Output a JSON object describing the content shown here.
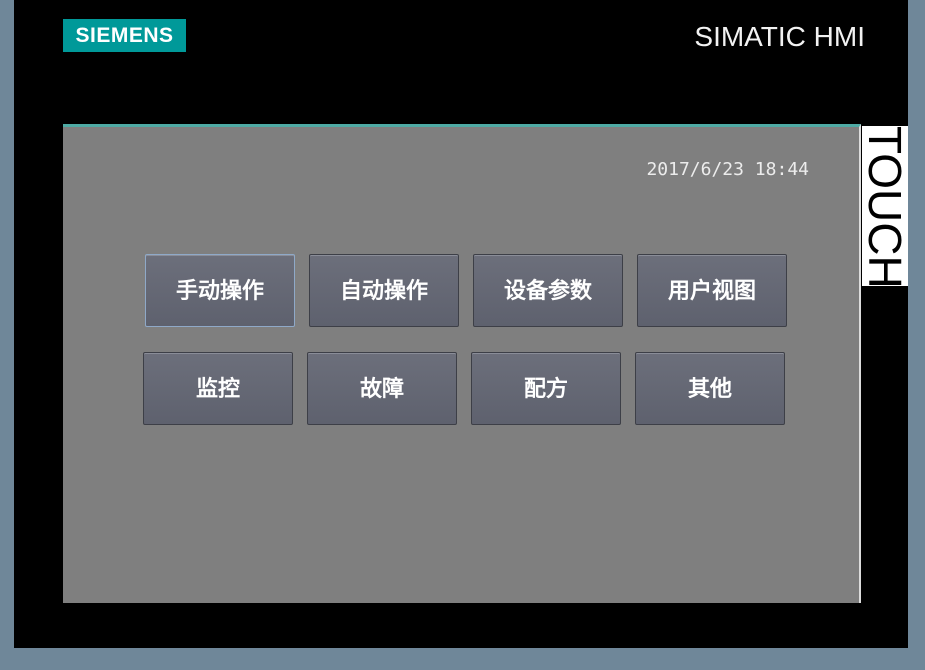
{
  "device": {
    "brand": "SIEMENS",
    "product": "SIMATIC HMI",
    "side_label": "TOUCH"
  },
  "screen": {
    "datetime": "2017/6/23  18:44",
    "buttons": [
      {
        "label": "手动操作"
      },
      {
        "label": "自动操作"
      },
      {
        "label": "设备参数"
      },
      {
        "label": "用户视图"
      },
      {
        "label": "监控"
      },
      {
        "label": "故障"
      },
      {
        "label": "配方"
      },
      {
        "label": "其他"
      }
    ]
  },
  "colors": {
    "brand_teal": "#009999",
    "screen_background": "#7f7f7f",
    "button_fill": "#666974",
    "bezel": "#000000"
  }
}
